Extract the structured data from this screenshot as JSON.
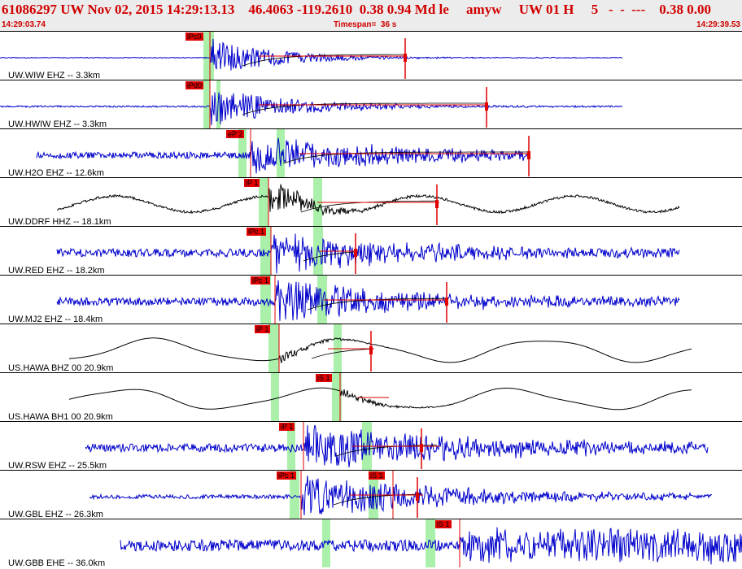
{
  "header": {
    "title": "61086297 UW Nov 02, 2015 14:29:13.13    46.4063 -119.2610  0.38 0.94 Md le     amyw     UW 01 H     5   -  -  ---    0.38 0.00",
    "start_time": "14:29:03.74",
    "timespan": "Timespan=  36 s",
    "end_time": "14:29:39.53"
  },
  "colors": {
    "header_text": "#d00000",
    "pick": "#e00000",
    "window": "#aaf0aa",
    "trace_blue": "#0000cc",
    "trace_black": "#000000"
  },
  "panels": [
    {
      "label": "UW.WIW EHZ -- 3.3km",
      "color": "#0000cc",
      "picks": [
        {
          "text": "iPc0"
        }
      ]
    },
    {
      "label": "UW.HWIW EHZ -- 3.3km",
      "color": "#0000cc",
      "picks": [
        {
          "text": "iPd0"
        }
      ]
    },
    {
      "label": "UW.H2O EHZ -- 12.6km",
      "color": "#0000cc",
      "picks": [
        {
          "text": "eP 2"
        }
      ]
    },
    {
      "label": "UW.DDRF HHZ -- 18.1km",
      "color": "#000000",
      "picks": [
        {
          "text": "iP 1"
        }
      ]
    },
    {
      "label": "UW.RED EHZ -- 18.2km",
      "color": "#0000cc",
      "picks": [
        {
          "text": "iPc 1"
        }
      ]
    },
    {
      "label": "UW.MJ2 EHZ -- 18.4km",
      "color": "#0000cc",
      "picks": [
        {
          "text": "iPc 1"
        }
      ]
    },
    {
      "label": "US.HAWA BHZ 00 20.9km",
      "color": "#000000",
      "picks": [
        {
          "text": "iP 1"
        }
      ]
    },
    {
      "label": "US.HAWA BH1 00 20.9km",
      "color": "#000000",
      "picks": [
        {
          "text": "iS 1"
        }
      ]
    },
    {
      "label": "UW.RSW EHZ -- 25.5km",
      "color": "#0000cc",
      "picks": [
        {
          "text": "iP 1"
        }
      ]
    },
    {
      "label": "UW.GBL EHZ -- 26.3km",
      "color": "#0000cc",
      "picks": [
        {
          "text": "iPc 1"
        },
        {
          "text": "iS 1"
        }
      ]
    },
    {
      "label": "UW.GBB EHE -- 36.0km",
      "color": "#0000cc",
      "picks": [
        {
          "text": "iS 1"
        }
      ]
    }
  ]
}
